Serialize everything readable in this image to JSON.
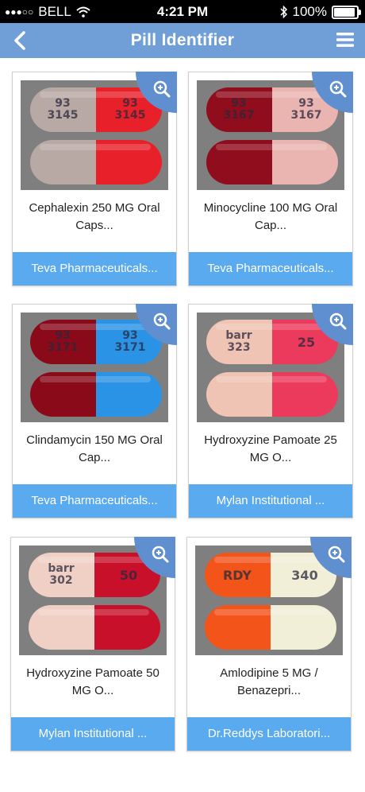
{
  "status": {
    "carrier": "BELL",
    "time": "4:21 PM",
    "battery": "100%",
    "battery_level": 1.0
  },
  "nav": {
    "title": "Pill Identifier"
  },
  "pills": [
    {
      "name": "Cephalexin 250 MG Oral Caps...",
      "manufacturer": "Teva Pharmaceuticals...",
      "imprint_left": "93\n3145",
      "imprint_right": "93\n3145",
      "color_left": "#b9a9a4",
      "color_right": "#e8202a"
    },
    {
      "name": "Minocycline 100 MG Oral Cap...",
      "manufacturer": "Teva Pharmaceuticals...",
      "imprint_left": "93\n3167",
      "imprint_right": "93\n3167",
      "color_left": "#8f0d1c",
      "color_right": "#eab4b0"
    },
    {
      "name": "Clindamycin 150 MG Oral Cap...",
      "manufacturer": "Teva Pharmaceuticals...",
      "imprint_left": "93\n3171",
      "imprint_right": "93\n3171",
      "color_left": "#8a0a1a",
      "color_right": "#2b93e6"
    },
    {
      "name": "Hydroxyzine Pamoate 25 MG O...",
      "manufacturer": "Mylan Institutional ...",
      "imprint_left": "barr\n323",
      "imprint_right": "25",
      "color_left": "#f0c4b4",
      "color_right": "#ec3a5c"
    },
    {
      "name": "Hydroxyzine Pamoate 50 MG O...",
      "manufacturer": "Mylan Institutional ...",
      "imprint_left": "barr\n302",
      "imprint_right": "50",
      "color_left": "#f0d0c4",
      "color_right": "#c8102a"
    },
    {
      "name": "Amlodipine 5 MG / Benazepri...",
      "manufacturer": "Dr.Reddys Laboratori...",
      "imprint_left": "RDY",
      "imprint_right": "340",
      "color_left": "#f2541a",
      "color_right": "#f2efd8"
    }
  ]
}
